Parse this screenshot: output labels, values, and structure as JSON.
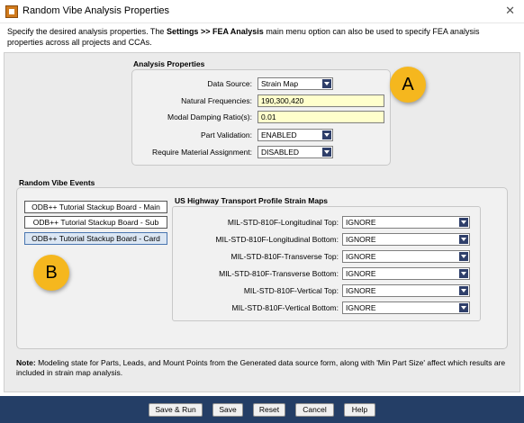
{
  "window": {
    "title": "Random Vibe Analysis Properties",
    "close_glyph": "✕"
  },
  "description": {
    "part1": "Specify the desired analysis properties. The ",
    "bold": "Settings >> FEA Analysis",
    "part2": " main menu option can also be used to specify FEA analysis properties across all projects and CCAs."
  },
  "analysis_properties": {
    "title": "Analysis Properties",
    "data_source": {
      "label": "Data Source:",
      "value": "Strain Map"
    },
    "natural_frequencies": {
      "label": "Natural Frequencies:",
      "value": "190,300,420"
    },
    "modal_damping": {
      "label": "Modal Damping Ratio(s):",
      "value": "0.01"
    },
    "part_validation": {
      "label": "Part Validation:",
      "value": "ENABLED"
    },
    "require_material": {
      "label": "Require Material Assignment:",
      "value": "DISABLED"
    }
  },
  "random_vibe_events": {
    "title": "Random Vibe Events",
    "items": [
      "ODB++ Tutorial Stackup Board - Main",
      "ODB++ Tutorial Stackup Board - Sub",
      "ODB++ Tutorial Stackup Board - Card"
    ]
  },
  "strain_maps": {
    "title": "US Highway Transport Profile Strain Maps",
    "rows": [
      {
        "label": "MIL-STD-810F-Longitudinal Top:",
        "value": "IGNORE"
      },
      {
        "label": "MIL-STD-810F-Longitudinal Bottom:",
        "value": "IGNORE"
      },
      {
        "label": "MIL-STD-810F-Transverse Top:",
        "value": "IGNORE"
      },
      {
        "label": "MIL-STD-810F-Transverse Bottom:",
        "value": "IGNORE"
      },
      {
        "label": "MIL-STD-810F-Vertical Top:",
        "value": "IGNORE"
      },
      {
        "label": "MIL-STD-810F-Vertical Bottom:",
        "value": "IGNORE"
      }
    ]
  },
  "callouts": {
    "a": "A",
    "b": "B",
    "color": "#f5b71e"
  },
  "note": {
    "bold": "Note:",
    "text": " Modeling state for Parts, Leads, and Mount Points from the Generated data source form, along with 'Min Part Size' affect which results are included in strain map analysis."
  },
  "buttons": {
    "save_run": "Save & Run",
    "save": "Save",
    "reset": "Reset",
    "cancel": "Cancel",
    "help": "Help"
  },
  "colors": {
    "footer": "#243e66",
    "dropdown_arrow": "#2f3f6a",
    "highlight_field": "#ffffcc"
  }
}
